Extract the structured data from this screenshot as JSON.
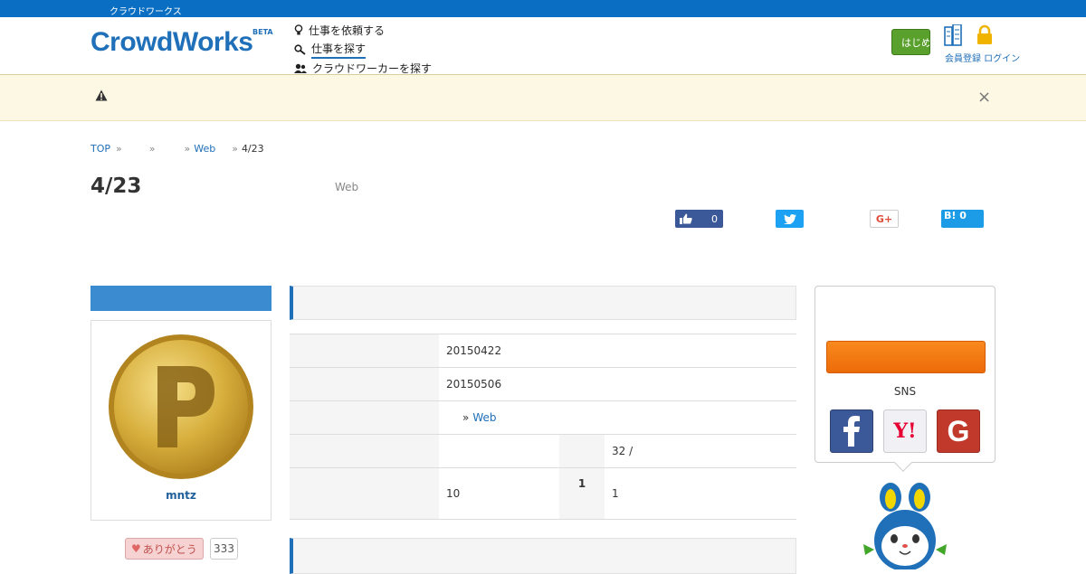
{
  "topbar": {
    "text": "クラウドワークス"
  },
  "header": {
    "logo": "CrowdWorks",
    "logo_badge": "BETA",
    "nav": [
      {
        "icon": "lightbulb-icon",
        "label": "仕事を依頼する"
      },
      {
        "icon": "search-icon",
        "label": "仕事を探す"
      },
      {
        "icon": "users-icon",
        "label": "クラウドワーカーを探す"
      }
    ],
    "login_label": "はじめての方",
    "links": "会員登録 ログイン"
  },
  "notice": {
    "icon": "warning-icon",
    "close": "×"
  },
  "breadcrumb": [
    {
      "label": "TOP",
      "link": true
    },
    {
      "label": "",
      "link": false
    },
    {
      "label": "",
      "link": false
    },
    {
      "label": "Web",
      "link": true
    },
    {
      "label": "4/23",
      "link": false
    }
  ],
  "job": {
    "title": "4/23",
    "category": "Web"
  },
  "share": {
    "facebook_count": "0",
    "google_label": "G+",
    "hatena_label": "B!",
    "hatena_count": "0"
  },
  "client": {
    "name": "mntz",
    "thanks_label": "ありがとう",
    "thanks_count": "333"
  },
  "details": {
    "posted": "20150422",
    "deadline": "20150506",
    "category_prefix": "»",
    "category_link": "Web",
    "applicants_value": "32 /",
    "contract_left": "10",
    "contract_mid": "1",
    "contract_right": "1"
  },
  "signup": {
    "sns_label": "SNS",
    "sns": [
      "facebook",
      "yahoo",
      "google"
    ],
    "colors": {
      "facebook": "#3b5998",
      "yahoo": "#f0f0f5",
      "google": "#c0392b"
    }
  }
}
